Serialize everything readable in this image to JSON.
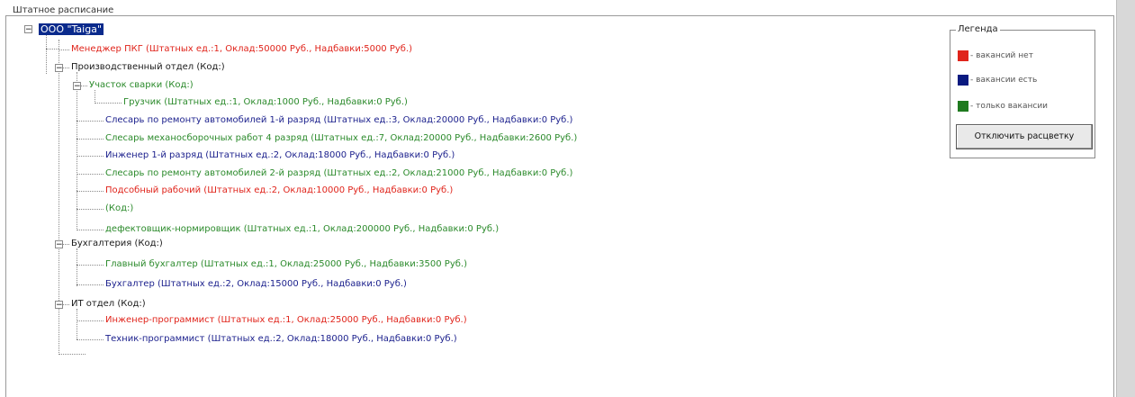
{
  "panel": {
    "caption": "Штатное расписание"
  },
  "tree": {
    "root": {
      "label": "ООО \"Taiga\"",
      "toggle": "−"
    },
    "manager": "Менеджер ПКГ (Штатных ед.:1, Оклад:50000 Руб., Надбавки:5000 Руб.)",
    "production": {
      "label": "Производственный отдел (Код:)",
      "toggle": "−",
      "welding": {
        "label": "Участок сварки (Код:)",
        "toggle": "−",
        "loader": "Грузчик (Штатных ед.:1, Оклад:1000 Руб., Надбавки:0 Руб.)"
      },
      "items": [
        "Слесарь по ремонту автомобилей 1-й разряд (Штатных ед.:3, Оклад:20000 Руб., Надбавки:0 Руб.)",
        "Слесарь механосборочных работ 4 разряд (Штатных ед.:7, Оклад:20000 Руб., Надбавки:2600 Руб.)",
        "Инженер 1-й разряд (Штатных ед.:2, Оклад:18000 Руб., Надбавки:0 Руб.)",
        "Слесарь по ремонту автомобилей 2-й разряд (Штатных ед.:2, Оклад:21000 Руб., Надбавки:0 Руб.)",
        "Подсобный рабочий (Штатных ед.:2, Оклад:10000 Руб., Надбавки:0 Руб.)",
        "(Код:)",
        "дефектовщик-нормировщик (Штатных ед.:1, Оклад:200000 Руб., Надбавки:0 Руб.)"
      ]
    },
    "accounting": {
      "label": "Бухгалтерия (Код:)",
      "toggle": "−",
      "items": [
        "Главный бухгалтер (Штатных ед.:1, Оклад:25000 Руб., Надбавки:3500 Руб.)",
        "Бухгалтер (Штатных ед.:2, Оклад:15000 Руб., Надбавки:0 Руб.)"
      ]
    },
    "it": {
      "label": "ИТ отдел (Код:)",
      "toggle": "−",
      "items": [
        "Инженер-программист (Штатных ед.:1, Оклад:25000 Руб., Надбавки:0 Руб.)",
        "Техник-программист (Штатных ед.:2, Оклад:18000 Руб., Надбавки:0 Руб.)"
      ]
    }
  },
  "legend": {
    "title": "Легенда",
    "items": [
      {
        "label": "- вакансий нет",
        "color": "#e0241b"
      },
      {
        "label": "- вакансии есть",
        "color": "#0a1a80"
      },
      {
        "label": "- только вакансии",
        "color": "#1f7a1f"
      }
    ],
    "button": "Отключить расцветку"
  },
  "colors": {
    "red": "#e0241b",
    "blue": "#1a1f8c",
    "green": "#2b8a2b",
    "selection": "#0a2a8c"
  }
}
